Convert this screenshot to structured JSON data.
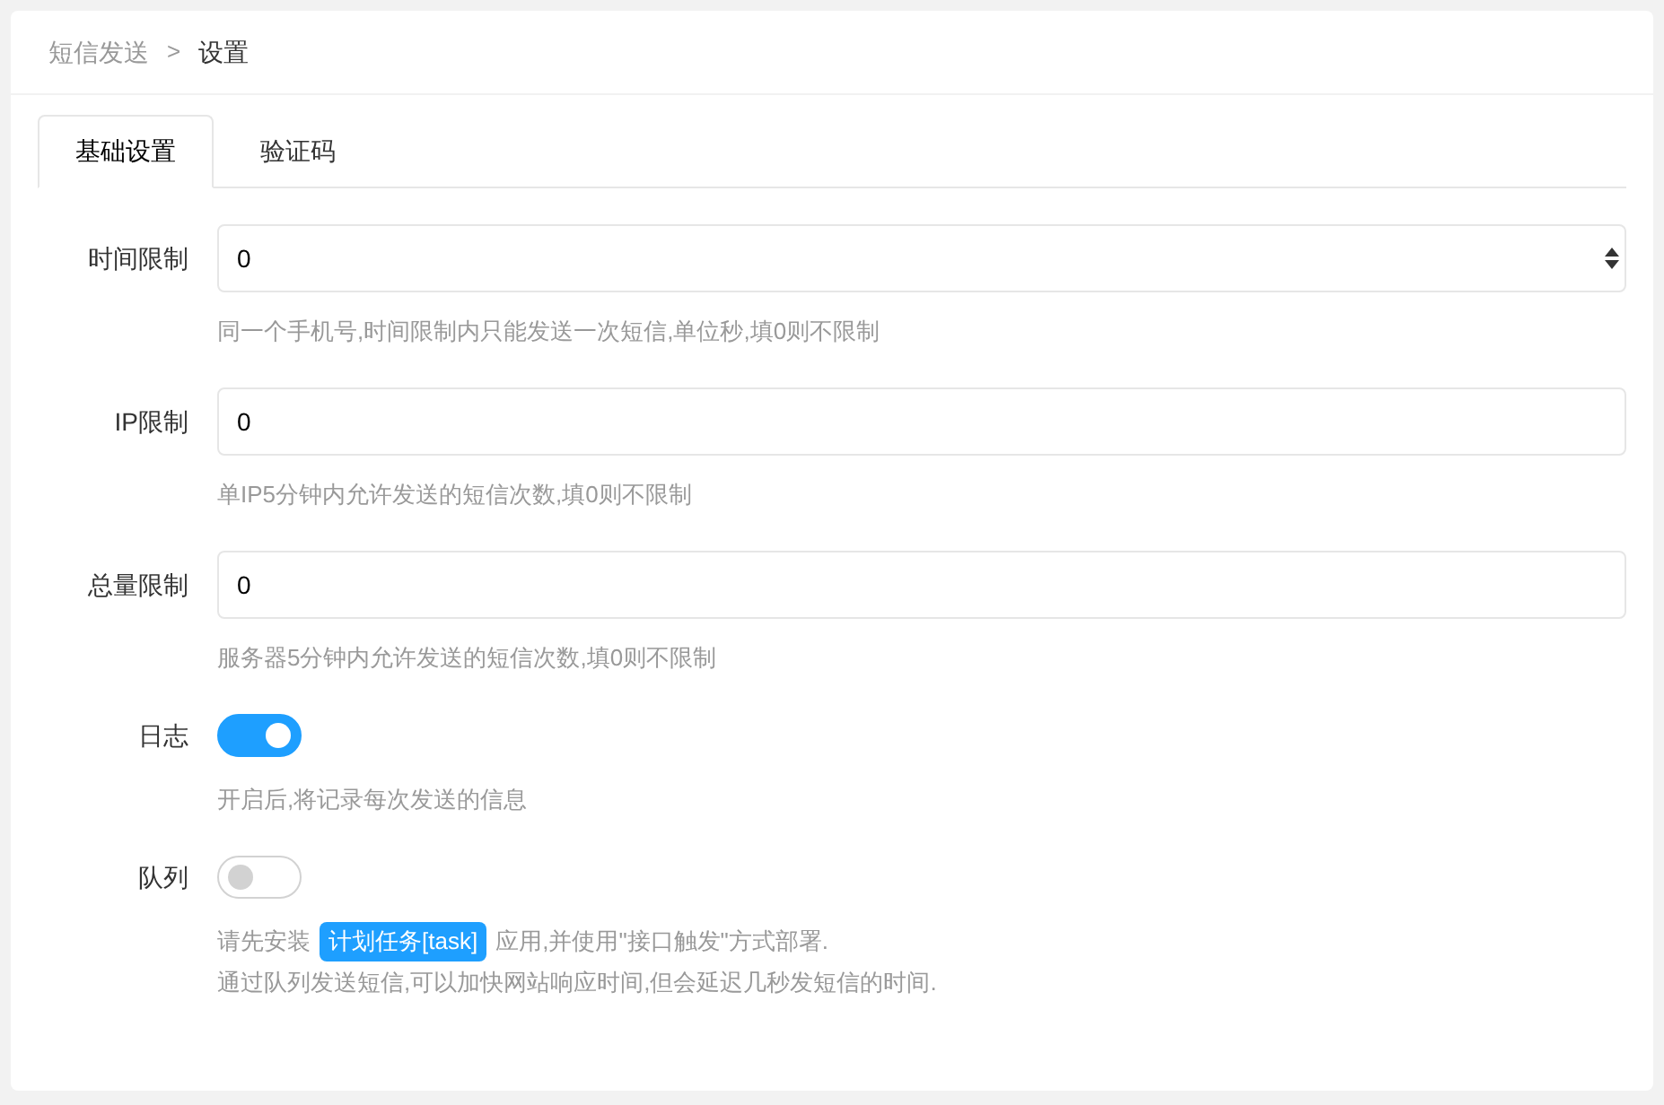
{
  "breadcrumb": [
    {
      "label": "短信发送",
      "current": false
    },
    {
      "label": "设置",
      "current": true
    }
  ],
  "breadcrumb_separator": ">",
  "tabs": [
    {
      "label": "基础设置",
      "selected": true
    },
    {
      "label": "验证码",
      "selected": false
    }
  ],
  "fields": [
    {
      "kind": "number",
      "label": "时间限制",
      "value": "0",
      "help": [
        "同一个手机号,时间限制内只能发送一次短信,单位秒,填0则不限制"
      ]
    },
    {
      "kind": "text",
      "label": "IP限制",
      "value": "0",
      "help": [
        "单IP5分钟内允许发送的短信次数,填0则不限制"
      ]
    },
    {
      "kind": "text",
      "label": "总量限制",
      "value": "0",
      "help": [
        "服务器5分钟内允许发送的短信次数,填0则不限制"
      ]
    },
    {
      "kind": "switch",
      "label": "日志",
      "on": true,
      "help": [
        "开启后,将记录每次发送的信息"
      ]
    },
    {
      "kind": "switch",
      "label": "队列",
      "on": false,
      "help_badge": {
        "before": "请先安装",
        "badge": "计划任务[task]",
        "after": "应用,并使用\"接口触发\"方式部署."
      },
      "help": [
        "通过队列发送短信,可以加快网站响应时间,但会延迟几秒发短信的时间."
      ]
    }
  ]
}
